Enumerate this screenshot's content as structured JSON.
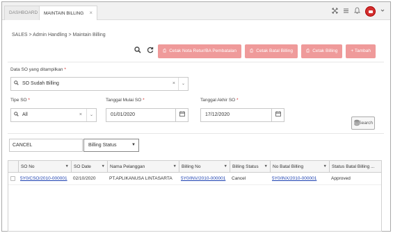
{
  "tabs": [
    {
      "label": "DASHBOARD"
    },
    {
      "label": "MAINTAIN BILLING",
      "close": "×"
    }
  ],
  "breadcrumb": "SALES > Admin Handling > Maintain Billing",
  "toolbar": {
    "cetak_nota_label": "Cetak Nota Retur/BA Pembatalan",
    "cetak_batal_label": "Cetak Batal Billing",
    "cetak_billing_label": "Cetak Billing",
    "tambah_label": "+ Tambah"
  },
  "filters": {
    "data_so_label": "Data SO yang ditampilkan",
    "data_so_value": "SO Sudah Billing",
    "tipe_so_label": "Tipe SO",
    "tipe_so_value": "All",
    "tgl_mulai_label": "Tanggal Mulai SO",
    "tgl_mulai_value": "01/01/2020",
    "tgl_akhir_label": "Tanggal Akhir SO",
    "tgl_akhir_value": "17/12/2020",
    "required_mark": "*",
    "clear_mark": "×",
    "search_label": "Search"
  },
  "quick_filter": {
    "text_value": "CANCEL",
    "select_value": "Billing Status"
  },
  "table": {
    "columns": [
      "SO No",
      "SO Date",
      "Nama Pelanggan",
      "Billing No",
      "Billing Status",
      "No Batal Billing",
      "Status Batal Billing ..."
    ],
    "rows": [
      [
        "5Y0/CSO/2010-000001",
        "02/10/2020",
        "PT.APLIKANUSA LINTASARTA",
        "5Y0/INV/2010-000001",
        "Cancel",
        "5Y0/INX/2010-000001",
        "Approved"
      ]
    ]
  },
  "colors": {
    "primary_button": "#ef9a9a",
    "link": "#1a3fb0",
    "required": "#d32f2f",
    "avatar": "#d32f2f"
  },
  "icons": [
    "search-icon",
    "refresh-icon",
    "expand-icon",
    "menu-icon",
    "bell-icon",
    "printer-icon",
    "calendar-icon",
    "database-icon",
    "sort-icon"
  ]
}
